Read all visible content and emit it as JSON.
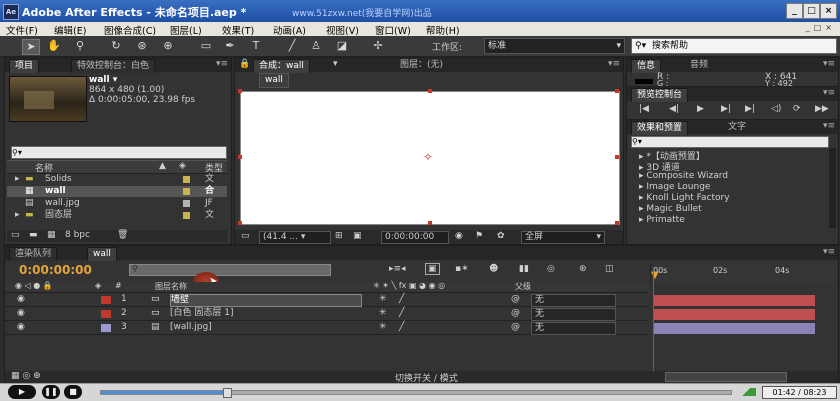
{
  "window": {
    "title": "Adobe After Effects - 未命名项目.aep *",
    "watermark": "www.51zxw.net(我要自学网)出品",
    "logo": "Ae"
  },
  "menu": [
    "文件(F)",
    "编辑(E)",
    "图像合成(C)",
    "图层(L)",
    "效果(T)",
    "动画(A)",
    "视图(V)",
    "窗口(W)",
    "帮助(H)"
  ],
  "toolbar": {
    "workspace_label": "工作区:",
    "workspace_value": "标准",
    "help_placeholder": "搜索帮助"
  },
  "project": {
    "tabs": [
      "项目",
      "特效控制台：白色"
    ],
    "item_name": "wall ▾",
    "item_size": "864 x 480 (1.00)",
    "item_duration": "Δ 0:00:05:00, 23.98 fps",
    "col_name": "名称",
    "col_type": "类型",
    "rows": [
      {
        "name": "Solids",
        "type": "文",
        "color": "#c9b34a"
      },
      {
        "name": "wall",
        "type": "合",
        "color": "#c9b34a"
      },
      {
        "name": "wall.jpg",
        "type": "JF",
        "color": "#b3b3b3"
      },
      {
        "name": "固态层",
        "type": "文",
        "color": "#c9b34a"
      }
    ],
    "bpc": "8 bpc"
  },
  "comp": {
    "tab": "合成：wall",
    "layer_tab": "图层：(无)",
    "sub_tab": "wall",
    "zoom": "(41.4 ...",
    "timecode": "0:00:00:00",
    "resolution": "全屏"
  },
  "info": {
    "tabs": [
      "信息",
      "音频"
    ],
    "r": "R :",
    "g": "G :",
    "x": "X : 641",
    "y": "Y : 492"
  },
  "preview": {
    "tab": "预览控制台"
  },
  "effects": {
    "tabs": [
      "效果和预置",
      "文字"
    ],
    "items": [
      "*【动画预置】",
      "3D 通道",
      "Composite Wizard",
      "Image Lounge",
      "Knoll Light Factory",
      "Magic Bullet",
      "Primatte"
    ]
  },
  "timeline": {
    "tabs": [
      "渲染队列",
      "wall"
    ],
    "time": "0:00:00:00",
    "col_layer_name": "图层名称",
    "col_parent": "父级",
    "ruler_labels": [
      "00s",
      "02s",
      "04s"
    ],
    "layers": [
      {
        "num": "1",
        "name": "墙壁",
        "parent": "无",
        "color": "#c0392b",
        "track": "#c05050"
      },
      {
        "num": "2",
        "name": "[白色 固态层 1]",
        "parent": "无",
        "color": "#c0392b",
        "track": "#c05050"
      },
      {
        "num": "3",
        "name": "[wall.jpg]",
        "parent": "无",
        "color": "#9a9ad0",
        "track": "#8d82b5"
      }
    ],
    "switch_mode": "切换开关 / 模式"
  },
  "player": {
    "time": "01:42 / 08:23",
    "progress": 0.2
  }
}
